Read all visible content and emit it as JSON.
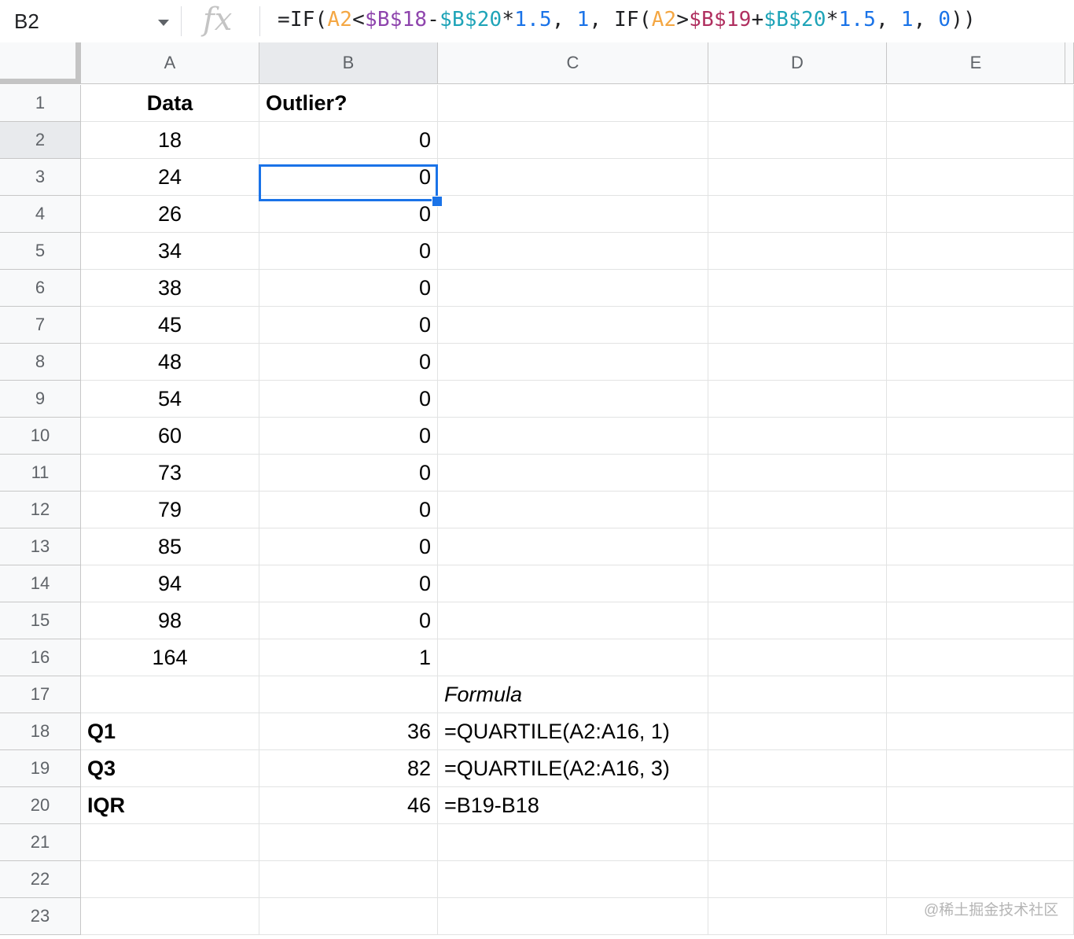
{
  "formula_bar": {
    "name_box": "B2",
    "fx_label": "fx",
    "formula_parts": [
      {
        "t": "=IF(",
        "c": "par"
      },
      {
        "t": "A2",
        "c": "ref1"
      },
      {
        "t": "<",
        "c": "par"
      },
      {
        "t": "$B$18",
        "c": "ref2"
      },
      {
        "t": "-",
        "c": "par"
      },
      {
        "t": "$B$20",
        "c": "ref3"
      },
      {
        "t": "*",
        "c": "par"
      },
      {
        "t": "1.5",
        "c": "num"
      },
      {
        "t": ", ",
        "c": "par"
      },
      {
        "t": "1",
        "c": "num"
      },
      {
        "t": ", IF(",
        "c": "par"
      },
      {
        "t": "A2",
        "c": "ref1"
      },
      {
        "t": ">",
        "c": "par"
      },
      {
        "t": "$B$19",
        "c": "ref4"
      },
      {
        "t": "+",
        "c": "par"
      },
      {
        "t": "$B$20",
        "c": "ref3"
      },
      {
        "t": "*",
        "c": "par"
      },
      {
        "t": "1.5",
        "c": "num"
      },
      {
        "t": ", ",
        "c": "par"
      },
      {
        "t": "1",
        "c": "num"
      },
      {
        "t": ", ",
        "c": "par"
      },
      {
        "t": "0",
        "c": "num"
      },
      {
        "t": "))",
        "c": "par"
      }
    ]
  },
  "columns": [
    "A",
    "B",
    "C",
    "D",
    "E"
  ],
  "rows": [
    {
      "n": "1",
      "A": "Data",
      "B": "Outlier?",
      "C": "",
      "A_style": "bold center",
      "B_style": "bold left"
    },
    {
      "n": "2",
      "A": "18",
      "B": "0",
      "C": ""
    },
    {
      "n": "3",
      "A": "24",
      "B": "0",
      "C": ""
    },
    {
      "n": "4",
      "A": "26",
      "B": "0",
      "C": ""
    },
    {
      "n": "5",
      "A": "34",
      "B": "0",
      "C": ""
    },
    {
      "n": "6",
      "A": "38",
      "B": "0",
      "C": ""
    },
    {
      "n": "7",
      "A": "45",
      "B": "0",
      "C": ""
    },
    {
      "n": "8",
      "A": "48",
      "B": "0",
      "C": ""
    },
    {
      "n": "9",
      "A": "54",
      "B": "0",
      "C": ""
    },
    {
      "n": "10",
      "A": "60",
      "B": "0",
      "C": ""
    },
    {
      "n": "11",
      "A": "73",
      "B": "0",
      "C": ""
    },
    {
      "n": "12",
      "A": "79",
      "B": "0",
      "C": ""
    },
    {
      "n": "13",
      "A": "85",
      "B": "0",
      "C": ""
    },
    {
      "n": "14",
      "A": "94",
      "B": "0",
      "C": ""
    },
    {
      "n": "15",
      "A": "98",
      "B": "0",
      "C": ""
    },
    {
      "n": "16",
      "A": "164",
      "B": "1",
      "C": ""
    },
    {
      "n": "17",
      "A": "",
      "B": "",
      "C": "Formula",
      "C_style": "italic left"
    },
    {
      "n": "18",
      "A": "Q1",
      "B": "36",
      "C": "=QUARTILE(A2:A16, 1)",
      "A_style": "bold left"
    },
    {
      "n": "19",
      "A": "Q3",
      "B": "82",
      "C": "=QUARTILE(A2:A16, 3)",
      "A_style": "bold left"
    },
    {
      "n": "20",
      "A": "IQR",
      "B": "46",
      "C": "=B19-B18",
      "A_style": "bold left"
    },
    {
      "n": "21",
      "A": "",
      "B": "",
      "C": ""
    },
    {
      "n": "22",
      "A": "",
      "B": "",
      "C": ""
    },
    {
      "n": "23",
      "A": "",
      "B": "",
      "C": ""
    }
  ],
  "selected_cell": "B2",
  "watermark": "@稀土掘金技术社区"
}
